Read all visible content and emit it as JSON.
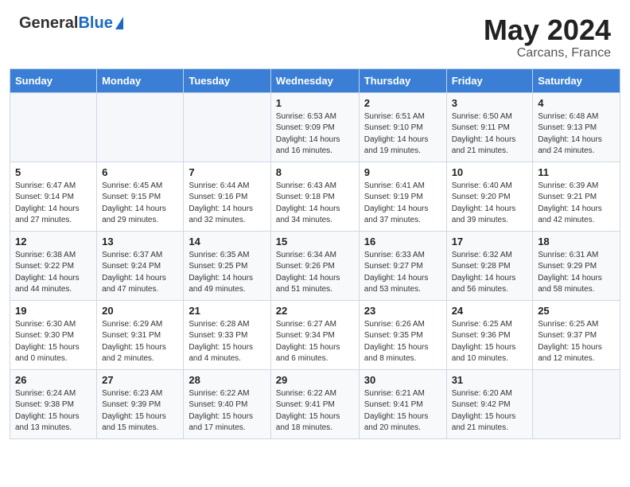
{
  "header": {
    "logo_general": "General",
    "logo_blue": "Blue",
    "title": "May 2024",
    "location": "Carcans, France"
  },
  "weekdays": [
    "Sunday",
    "Monday",
    "Tuesday",
    "Wednesday",
    "Thursday",
    "Friday",
    "Saturday"
  ],
  "weeks": [
    [
      {
        "day": "",
        "info": ""
      },
      {
        "day": "",
        "info": ""
      },
      {
        "day": "",
        "info": ""
      },
      {
        "day": "1",
        "info": "Sunrise: 6:53 AM\nSunset: 9:09 PM\nDaylight: 14 hours and 16 minutes."
      },
      {
        "day": "2",
        "info": "Sunrise: 6:51 AM\nSunset: 9:10 PM\nDaylight: 14 hours and 19 minutes."
      },
      {
        "day": "3",
        "info": "Sunrise: 6:50 AM\nSunset: 9:11 PM\nDaylight: 14 hours and 21 minutes."
      },
      {
        "day": "4",
        "info": "Sunrise: 6:48 AM\nSunset: 9:13 PM\nDaylight: 14 hours and 24 minutes."
      }
    ],
    [
      {
        "day": "5",
        "info": "Sunrise: 6:47 AM\nSunset: 9:14 PM\nDaylight: 14 hours and 27 minutes."
      },
      {
        "day": "6",
        "info": "Sunrise: 6:45 AM\nSunset: 9:15 PM\nDaylight: 14 hours and 29 minutes."
      },
      {
        "day": "7",
        "info": "Sunrise: 6:44 AM\nSunset: 9:16 PM\nDaylight: 14 hours and 32 minutes."
      },
      {
        "day": "8",
        "info": "Sunrise: 6:43 AM\nSunset: 9:18 PM\nDaylight: 14 hours and 34 minutes."
      },
      {
        "day": "9",
        "info": "Sunrise: 6:41 AM\nSunset: 9:19 PM\nDaylight: 14 hours and 37 minutes."
      },
      {
        "day": "10",
        "info": "Sunrise: 6:40 AM\nSunset: 9:20 PM\nDaylight: 14 hours and 39 minutes."
      },
      {
        "day": "11",
        "info": "Sunrise: 6:39 AM\nSunset: 9:21 PM\nDaylight: 14 hours and 42 minutes."
      }
    ],
    [
      {
        "day": "12",
        "info": "Sunrise: 6:38 AM\nSunset: 9:22 PM\nDaylight: 14 hours and 44 minutes."
      },
      {
        "day": "13",
        "info": "Sunrise: 6:37 AM\nSunset: 9:24 PM\nDaylight: 14 hours and 47 minutes."
      },
      {
        "day": "14",
        "info": "Sunrise: 6:35 AM\nSunset: 9:25 PM\nDaylight: 14 hours and 49 minutes."
      },
      {
        "day": "15",
        "info": "Sunrise: 6:34 AM\nSunset: 9:26 PM\nDaylight: 14 hours and 51 minutes."
      },
      {
        "day": "16",
        "info": "Sunrise: 6:33 AM\nSunset: 9:27 PM\nDaylight: 14 hours and 53 minutes."
      },
      {
        "day": "17",
        "info": "Sunrise: 6:32 AM\nSunset: 9:28 PM\nDaylight: 14 hours and 56 minutes."
      },
      {
        "day": "18",
        "info": "Sunrise: 6:31 AM\nSunset: 9:29 PM\nDaylight: 14 hours and 58 minutes."
      }
    ],
    [
      {
        "day": "19",
        "info": "Sunrise: 6:30 AM\nSunset: 9:30 PM\nDaylight: 15 hours and 0 minutes."
      },
      {
        "day": "20",
        "info": "Sunrise: 6:29 AM\nSunset: 9:31 PM\nDaylight: 15 hours and 2 minutes."
      },
      {
        "day": "21",
        "info": "Sunrise: 6:28 AM\nSunset: 9:33 PM\nDaylight: 15 hours and 4 minutes."
      },
      {
        "day": "22",
        "info": "Sunrise: 6:27 AM\nSunset: 9:34 PM\nDaylight: 15 hours and 6 minutes."
      },
      {
        "day": "23",
        "info": "Sunrise: 6:26 AM\nSunset: 9:35 PM\nDaylight: 15 hours and 8 minutes."
      },
      {
        "day": "24",
        "info": "Sunrise: 6:25 AM\nSunset: 9:36 PM\nDaylight: 15 hours and 10 minutes."
      },
      {
        "day": "25",
        "info": "Sunrise: 6:25 AM\nSunset: 9:37 PM\nDaylight: 15 hours and 12 minutes."
      }
    ],
    [
      {
        "day": "26",
        "info": "Sunrise: 6:24 AM\nSunset: 9:38 PM\nDaylight: 15 hours and 13 minutes."
      },
      {
        "day": "27",
        "info": "Sunrise: 6:23 AM\nSunset: 9:39 PM\nDaylight: 15 hours and 15 minutes."
      },
      {
        "day": "28",
        "info": "Sunrise: 6:22 AM\nSunset: 9:40 PM\nDaylight: 15 hours and 17 minutes."
      },
      {
        "day": "29",
        "info": "Sunrise: 6:22 AM\nSunset: 9:41 PM\nDaylight: 15 hours and 18 minutes."
      },
      {
        "day": "30",
        "info": "Sunrise: 6:21 AM\nSunset: 9:41 PM\nDaylight: 15 hours and 20 minutes."
      },
      {
        "day": "31",
        "info": "Sunrise: 6:20 AM\nSunset: 9:42 PM\nDaylight: 15 hours and 21 minutes."
      },
      {
        "day": "",
        "info": ""
      }
    ]
  ],
  "shaded_rows": [
    0,
    2,
    4
  ],
  "empty_days_week0": [
    0,
    1,
    2
  ],
  "empty_days_week4": [
    6
  ]
}
